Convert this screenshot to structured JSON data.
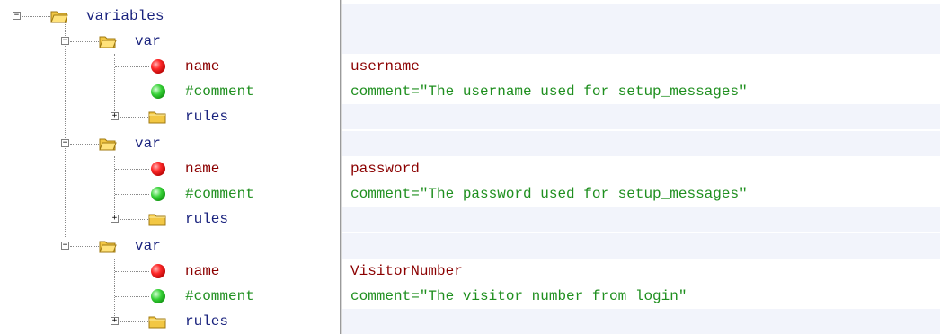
{
  "tree": {
    "root_label": "variables",
    "var_label": "var",
    "name_label": "name",
    "comment_label": "#comment",
    "rules_label": "rules",
    "expanded_symbol": "−",
    "collapsed_symbol": "+"
  },
  "values": {
    "var1_name": "username",
    "var1_comment": "comment=\"The username used for setup_messages\"",
    "var2_name": "password",
    "var2_comment": "comment=\"The password used for setup_messages\"",
    "var3_name": "VisitorNumber",
    "var3_comment": "comment=\"The visitor number from login\""
  },
  "colors": {
    "folder_text": "#1a237e",
    "name_text": "#8b0000",
    "comment_text": "#1f8f1f"
  }
}
